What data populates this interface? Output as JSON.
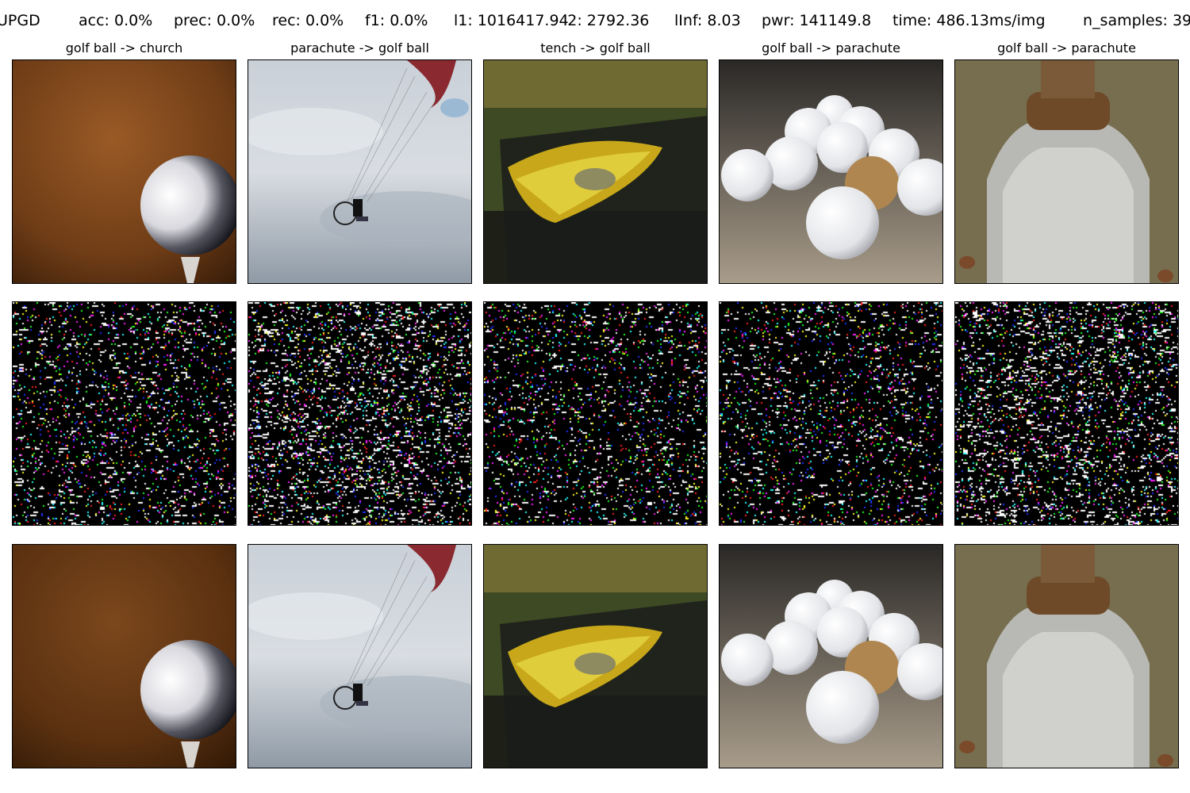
{
  "header": {
    "method": "UPGD",
    "acc": "acc: 0.0%",
    "prec": "prec: 0.0%",
    "rec": "rec: 0.0%",
    "f1": "f1: 0.0%",
    "l1": "l1: 1016417.94",
    "l2": "l2: 2792.36",
    "linf": "lInf: 8.03",
    "pwr": "pwr: 141149.8",
    "time": "time: 486.13ms/img",
    "n_samples": "n_samples: 39"
  },
  "columns": [
    {
      "label": "golf ball -> church"
    },
    {
      "label": "parachute -> golf ball"
    },
    {
      "label": "tench -> golf ball"
    },
    {
      "label": "golf ball -> parachute"
    },
    {
      "label": "golf ball -> parachute"
    }
  ],
  "rows": [
    "original",
    "perturbation",
    "adversarial"
  ]
}
